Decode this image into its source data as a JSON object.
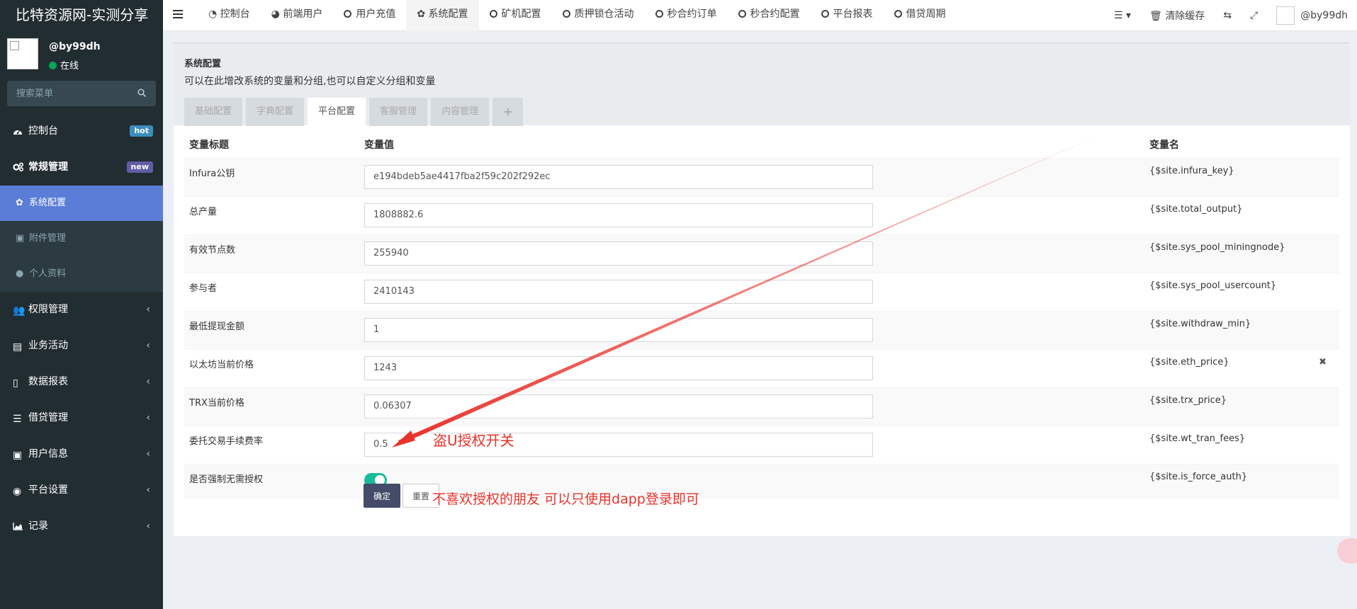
{
  "app": {
    "title": "比特资源网-实测分享"
  },
  "user": {
    "name": "@by99dh",
    "status": "在线"
  },
  "search": {
    "placeholder": "搜索菜单"
  },
  "sidebar": {
    "items": [
      {
        "label": "控制台",
        "badge": "hot",
        "icon": "dashboard-icon"
      },
      {
        "label": "常规管理",
        "badge": "new",
        "icon": "cogs-icon"
      },
      {
        "label": "权限管理",
        "icon": "users-icon"
      },
      {
        "label": "业务活动",
        "icon": "card-icon"
      },
      {
        "label": "数据报表",
        "icon": "file-icon"
      },
      {
        "label": "借贷管理",
        "icon": "list-icon"
      },
      {
        "label": "用户信息",
        "icon": "address-book-icon"
      },
      {
        "label": "平台设置",
        "icon": "circle-dot-icon"
      },
      {
        "label": "记录",
        "icon": "area-chart-icon"
      }
    ],
    "subitems": [
      {
        "label": "系统配置",
        "icon": "gear-icon"
      },
      {
        "label": "附件管理",
        "icon": "image-icon"
      },
      {
        "label": "个人资料",
        "icon": "user-icon"
      }
    ]
  },
  "topnav": {
    "tabs": [
      "控制台",
      "前端用户",
      "用户充值",
      "系统配置",
      "矿机配置",
      "质押锁仓活动",
      "秒合约订单",
      "秒合约配置",
      "平台报表",
      "借贷周期"
    ],
    "clear_cache": "清除缓存",
    "username": "@by99dh"
  },
  "panel": {
    "title": "系统配置",
    "description": "可以在此增改系统的变量和分组,也可以自定义分组和变量",
    "tabs": [
      "基础配置",
      "字典配置",
      "平台配置",
      "客服管理",
      "内容管理"
    ],
    "plus": "+"
  },
  "table": {
    "headers": {
      "title": "变量标题",
      "value": "变量值",
      "name": "变量名"
    },
    "rows": [
      {
        "title": "Infura公钥",
        "value": "e194bdeb5ae4417fba2f59c202f292ec",
        "name": "{$site.infura_key}"
      },
      {
        "title": "总产量",
        "value": "1808882.6",
        "name": "{$site.total_output}"
      },
      {
        "title": "有效节点数",
        "value": "255940",
        "name": "{$site.sys_pool_miningnode}"
      },
      {
        "title": "参与者",
        "value": "2410143",
        "name": "{$site.sys_pool_usercount}"
      },
      {
        "title": "最低提现金额",
        "value": "1",
        "name": "{$site.withdraw_min}"
      },
      {
        "title": "以太坊当前价格",
        "value": "1243",
        "name": "{$site.eth_price}"
      },
      {
        "title": "TRX当前价格",
        "value": "0.06307",
        "name": "{$site.trx_price}"
      },
      {
        "title": "委托交易手续费率",
        "value": "0.5",
        "name": "{$site.wt_tran_fees}"
      },
      {
        "title": "是否强制无需授权",
        "toggle_on": true,
        "name": "{$site.is_force_auth}"
      }
    ]
  },
  "buttons": {
    "confirm": "确定",
    "reset": "重置"
  },
  "annotations": {
    "switch_note": "盗U授权开关",
    "dapp_note": "不喜欢授权的朋友  可以只使用dapp登录即可"
  },
  "colors": {
    "sidebar_bg": "#222d32",
    "active_item": "#5b7dd8",
    "toggle_on": "#18bc9c",
    "annotation": "#e8322b",
    "confirm_btn": "#444c69"
  }
}
